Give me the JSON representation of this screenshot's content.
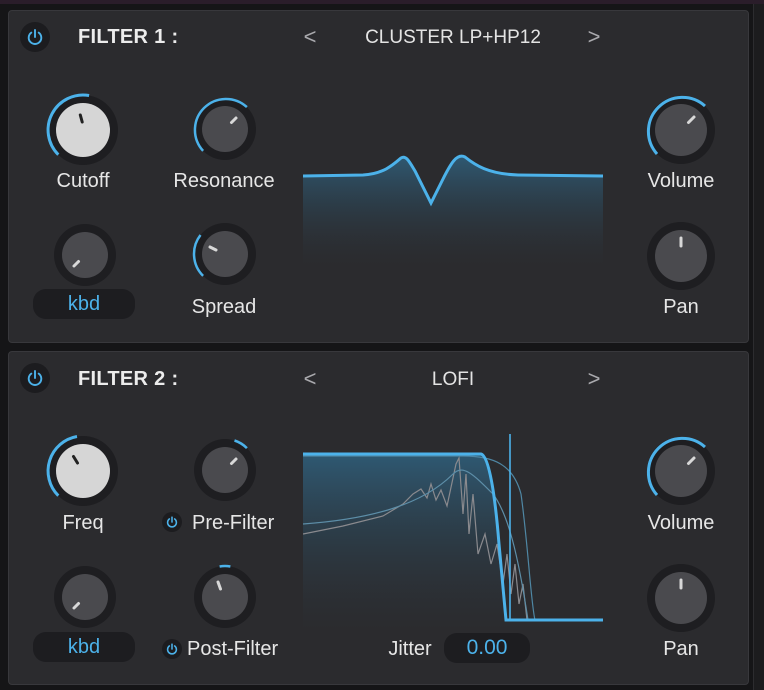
{
  "filter1": {
    "title": "FILTER 1 :",
    "preset": "CLUSTER LP+HP12",
    "knobs": {
      "cutoff": "Cutoff",
      "resonance": "Resonance",
      "spread": "Spread",
      "volume": "Volume",
      "pan": "Pan"
    },
    "kbd_label": "kbd"
  },
  "filter2": {
    "title": "FILTER 2 :",
    "preset": "LOFI",
    "knobs": {
      "freq": "Freq",
      "pre_filter": "Pre-Filter",
      "post_filter": "Post-Filter",
      "volume": "Volume",
      "pan": "Pan"
    },
    "kbd_label": "kbd",
    "jitter_label": "Jitter",
    "jitter_value": "0.00"
  },
  "icons": {
    "power": "power-icon",
    "prev": "chevron-left-icon",
    "next": "chevron-right-icon"
  },
  "nav": {
    "prev": "<",
    "next": ">"
  },
  "colors": {
    "accent": "#4cb2ea",
    "panel": "#2b2b2e",
    "background": "#151517",
    "knob_dark": "#4a4a4e",
    "knob_light": "#d6d6d6"
  }
}
